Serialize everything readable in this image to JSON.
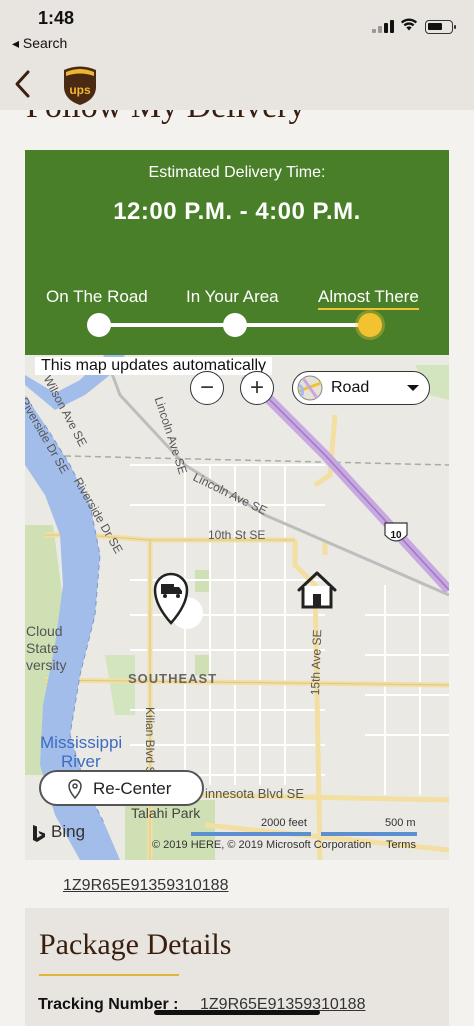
{
  "status_bar": {
    "time": "1:48",
    "back_app": "◂ Search"
  },
  "nav": {
    "logo_text": "ups"
  },
  "page": {
    "title": "Follow My Delivery"
  },
  "delivery": {
    "estimated_label": "Estimated Delivery Time:",
    "time_window": "12:00 P.M. - 4:00 P.M.",
    "stages": [
      "On The Road",
      "In Your Area",
      "Almost There"
    ],
    "current_stage": "Almost There",
    "accent_color": "#4a7f2a",
    "highlight_color": "#f2c231"
  },
  "map": {
    "note": "This map updates automatically",
    "zoom_out": "−",
    "zoom_in": "+",
    "map_type": "Road",
    "recenter": "Re-Center",
    "bing": "Bing",
    "copyright": "© 2019 HERE, © 2019 Microsoft Corporation",
    "terms": "Terms",
    "scale_feet": "2000 feet",
    "scale_meters": "500 m",
    "labels": {
      "wilson": "Wilson Ave SE",
      "lincoln1": "Lincoln Ave SE",
      "lincoln2": "Lincoln Ave SE",
      "riverside1": "Riverside Dr SE",
      "riverside2": "Riverside Dr SE",
      "tenth": "10th St SE",
      "fifteenth": "15th Ave SE",
      "kilian": "Kilian Blvd SE",
      "southeast": "SOUTHEAST",
      "cloud": "Cloud",
      "state": "State",
      "versity": "versity",
      "mississippi": "Mississippi",
      "river": "River",
      "minnesota": "innesota Blvd SE",
      "talahi": "Talahi Park",
      "highway": "10"
    }
  },
  "tracking_number_link": "1Z9R65E91359310188",
  "details": {
    "title": "Package Details",
    "tracking_label": "Tracking Number :",
    "tracking_value": "1Z9R65E91359310188"
  }
}
